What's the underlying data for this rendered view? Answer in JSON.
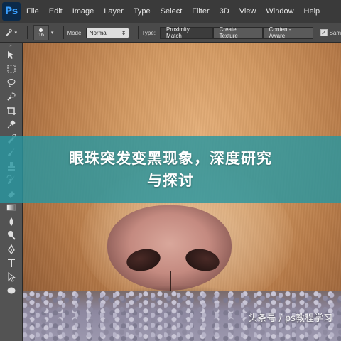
{
  "app": {
    "logo_text": "Ps"
  },
  "menu": [
    "File",
    "Edit",
    "Image",
    "Layer",
    "Type",
    "Select",
    "Filter",
    "3D",
    "View",
    "Window",
    "Help"
  ],
  "options": {
    "brush_size": "16",
    "mode_label": "Mode:",
    "mode_value": "Normal",
    "type_label": "Type:",
    "type_buttons": [
      "Proximity Match",
      "Create Texture",
      "Content-Aware"
    ],
    "type_active_index": 0,
    "sample_label": "Sam"
  },
  "tools": [
    "move-icon",
    "marquee-icon",
    "lasso-icon",
    "quick-selection-icon",
    "crop-icon",
    "eyedropper-icon",
    "spot-healing-brush-icon",
    "brush-icon",
    "clone-stamp-icon",
    "history-brush-icon",
    "eraser-icon",
    "gradient-icon",
    "blur-icon",
    "dodge-icon",
    "pen-icon",
    "type-icon",
    "path-selection-icon",
    "ellipse-icon"
  ],
  "overlay": {
    "title_line1": "眼珠突发变黑现象，深度研究",
    "title_line2": "与探讨"
  },
  "watermark": "头条号 / ps教程学习",
  "colors": {
    "banner": "#2896a0",
    "menubar": "#3a3a3a",
    "toolbar": "#535353"
  }
}
